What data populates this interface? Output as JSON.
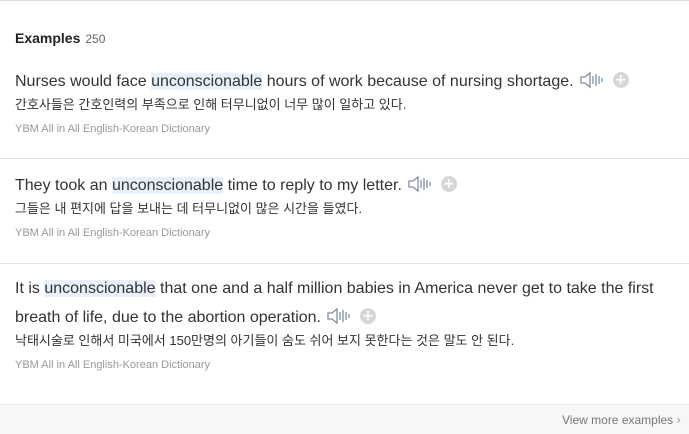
{
  "header": {
    "title": "Examples",
    "count": "250"
  },
  "examples": [
    {
      "en_before": "Nurses would face ",
      "keyword": "unconscionable",
      "en_after": " hours of work because of nursing shortage.",
      "ko": "간호사들은 간호인력의 부족으로 인해 터무니없이 너무 많이 일하고 있다.",
      "source": "YBM All in All English-Korean Dictionary"
    },
    {
      "en_before": "They took an ",
      "keyword": "unconscionable",
      "en_after": " time to reply to my letter.",
      "ko": "그들은 내 편지에 답을 보내는 데 터무니없이 많은 시간을 들였다.",
      "source": "YBM All in All English-Korean Dictionary"
    },
    {
      "en_before": "It is ",
      "keyword": "unconscionable",
      "en_after": " that one and a half million babies in America never get to take the first breath of life, due to the abortion operation.",
      "ko": "낙태시술로 인해서 미국에서 150만명의 아기들이 숨도 쉬어 보지 못한다는 것은 말도 안 된다.",
      "source": "YBM All in All English-Korean Dictionary"
    }
  ],
  "icons": {
    "audio": "speaker-icon",
    "add": "plus-icon",
    "more": "chevron-right-icon"
  },
  "plus_glyph": "+",
  "footer": {
    "more_label": "View more examples",
    "chevron": "›"
  },
  "colors": {
    "highlight": "#e8f1fb",
    "source_text": "#999999",
    "plus_bg": "#d7d7d7"
  }
}
